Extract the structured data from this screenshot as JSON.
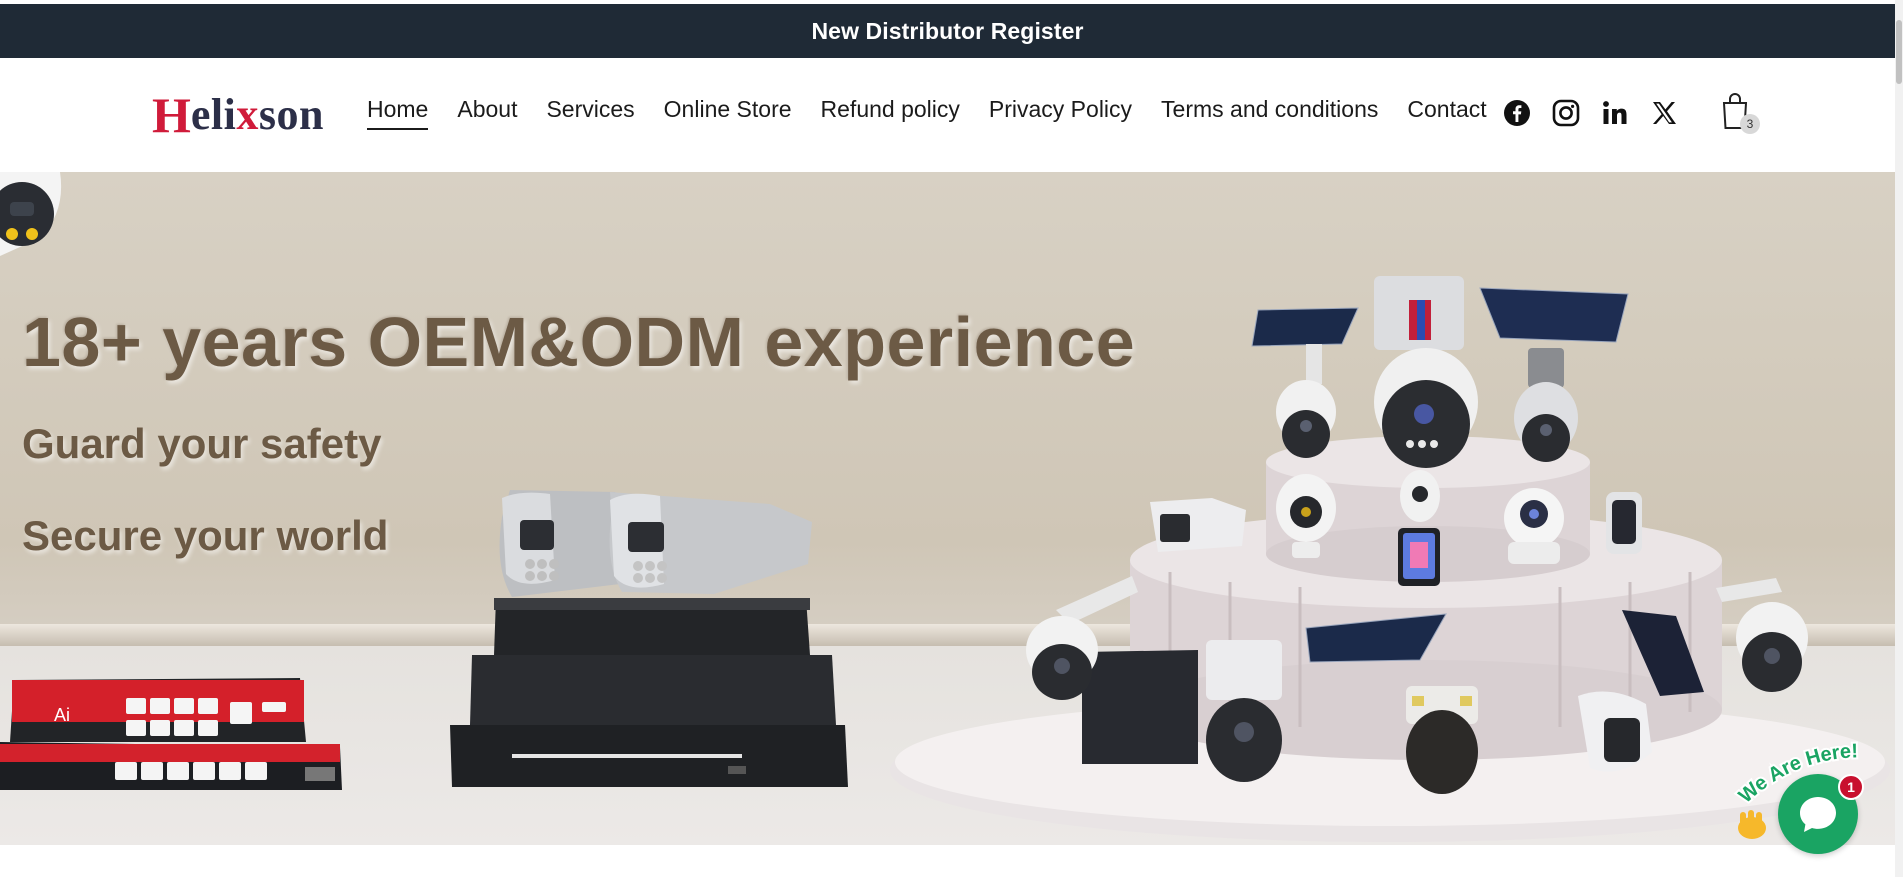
{
  "topbar": {
    "link_label": "New Distributor Register"
  },
  "header": {
    "logo_first": "H",
    "logo_mid_a": "eli",
    "logo_x": "x",
    "logo_mid_b": "son",
    "nav": [
      {
        "label": "Home",
        "active": true
      },
      {
        "label": "About"
      },
      {
        "label": "Services"
      },
      {
        "label": "Online Store"
      },
      {
        "label": "Refund policy"
      },
      {
        "label": "Privacy Policy"
      },
      {
        "label": "Terms and conditions"
      },
      {
        "label": "Contact"
      }
    ],
    "socials": [
      "facebook-icon",
      "instagram-icon",
      "linkedin-icon",
      "x-icon"
    ],
    "cart_count": "3"
  },
  "hero": {
    "headline": "18+ years OEM&ODM experience",
    "line1": "Guard your safety",
    "line2": "Secure your world",
    "switch_label": "Ai"
  },
  "chat": {
    "callout": "We Are Here!",
    "badge_count": "1"
  },
  "colors": {
    "topbar_bg": "#1f2a36",
    "brand_red": "#d01b3a",
    "brand_dark": "#2c2f48",
    "hero_text": "#6c5a45",
    "chat_green": "#1aa463"
  }
}
